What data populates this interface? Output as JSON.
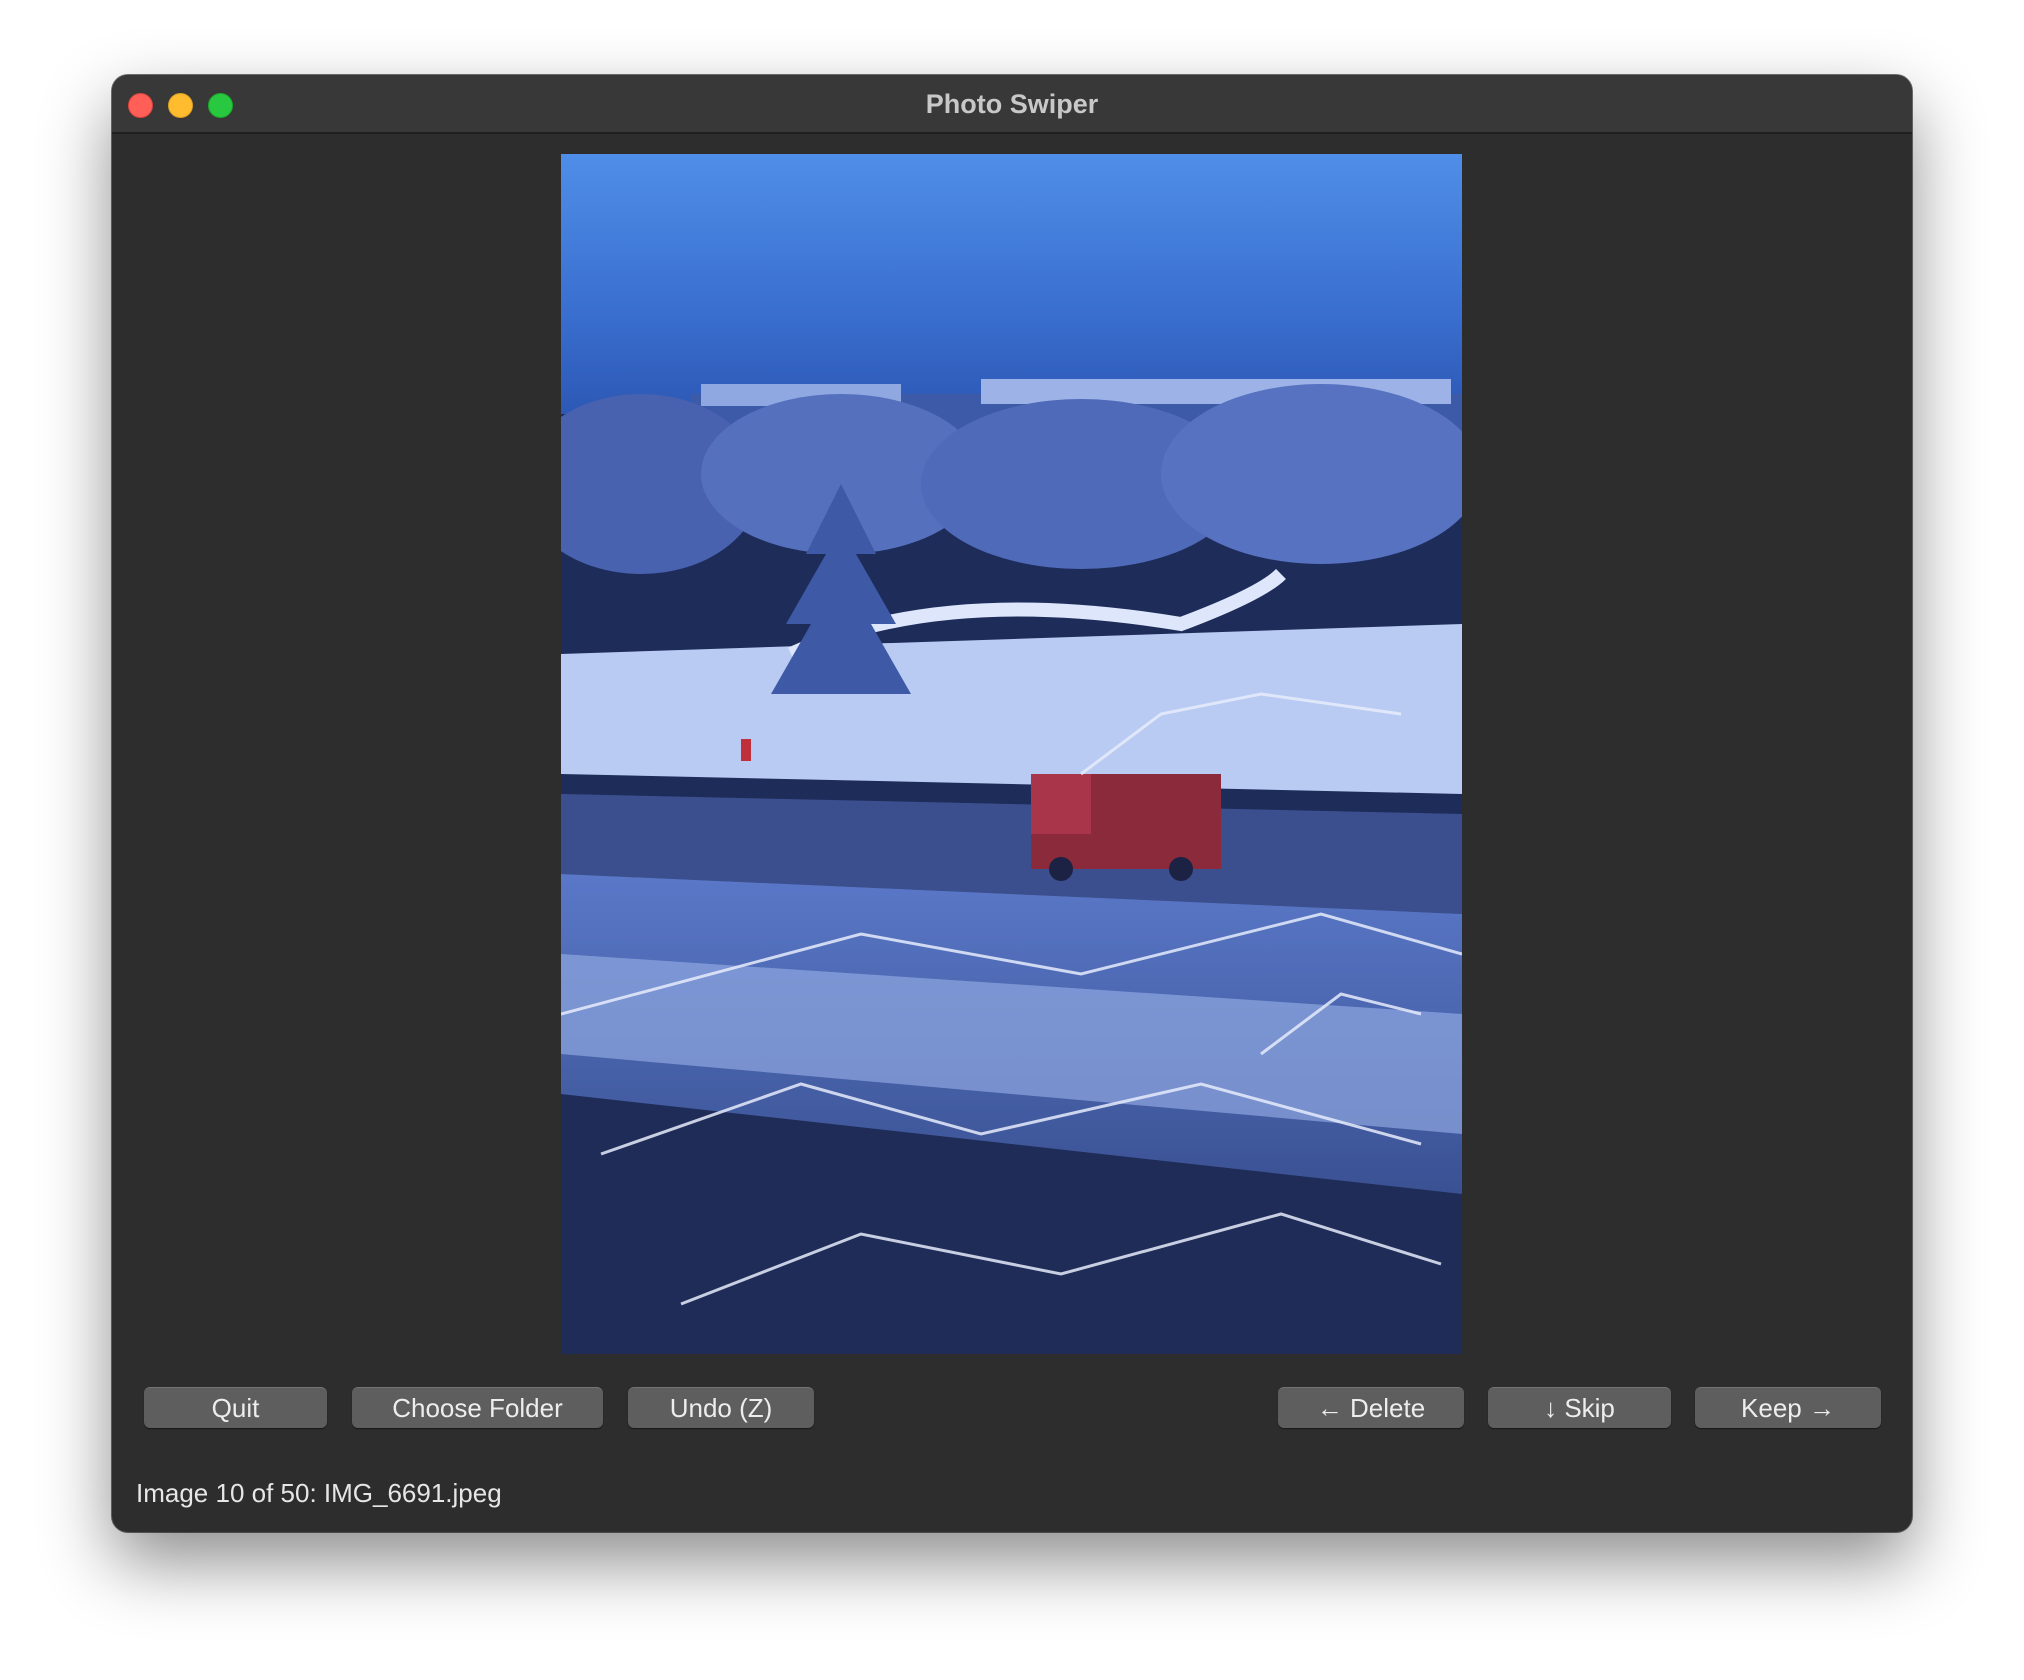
{
  "window": {
    "title": "Photo Swiper"
  },
  "photo": {
    "description_icon": "photo-viewer"
  },
  "toolbar": {
    "quit_label": "Quit",
    "choose_folder_label": "Choose Folder",
    "undo_label": "Undo (Z)",
    "delete_label": "← Delete",
    "skip_label": "↓ Skip",
    "keep_label": "Keep →"
  },
  "status": {
    "text": "Image 10 of 50: IMG_6691.jpeg"
  },
  "colors": {
    "window_bg": "#2d2d2d",
    "titlebar_bg": "#383838",
    "button_bg": "#5e5e5e",
    "close": "#ff5f57",
    "minimize": "#febc2e",
    "zoom": "#28c840"
  }
}
